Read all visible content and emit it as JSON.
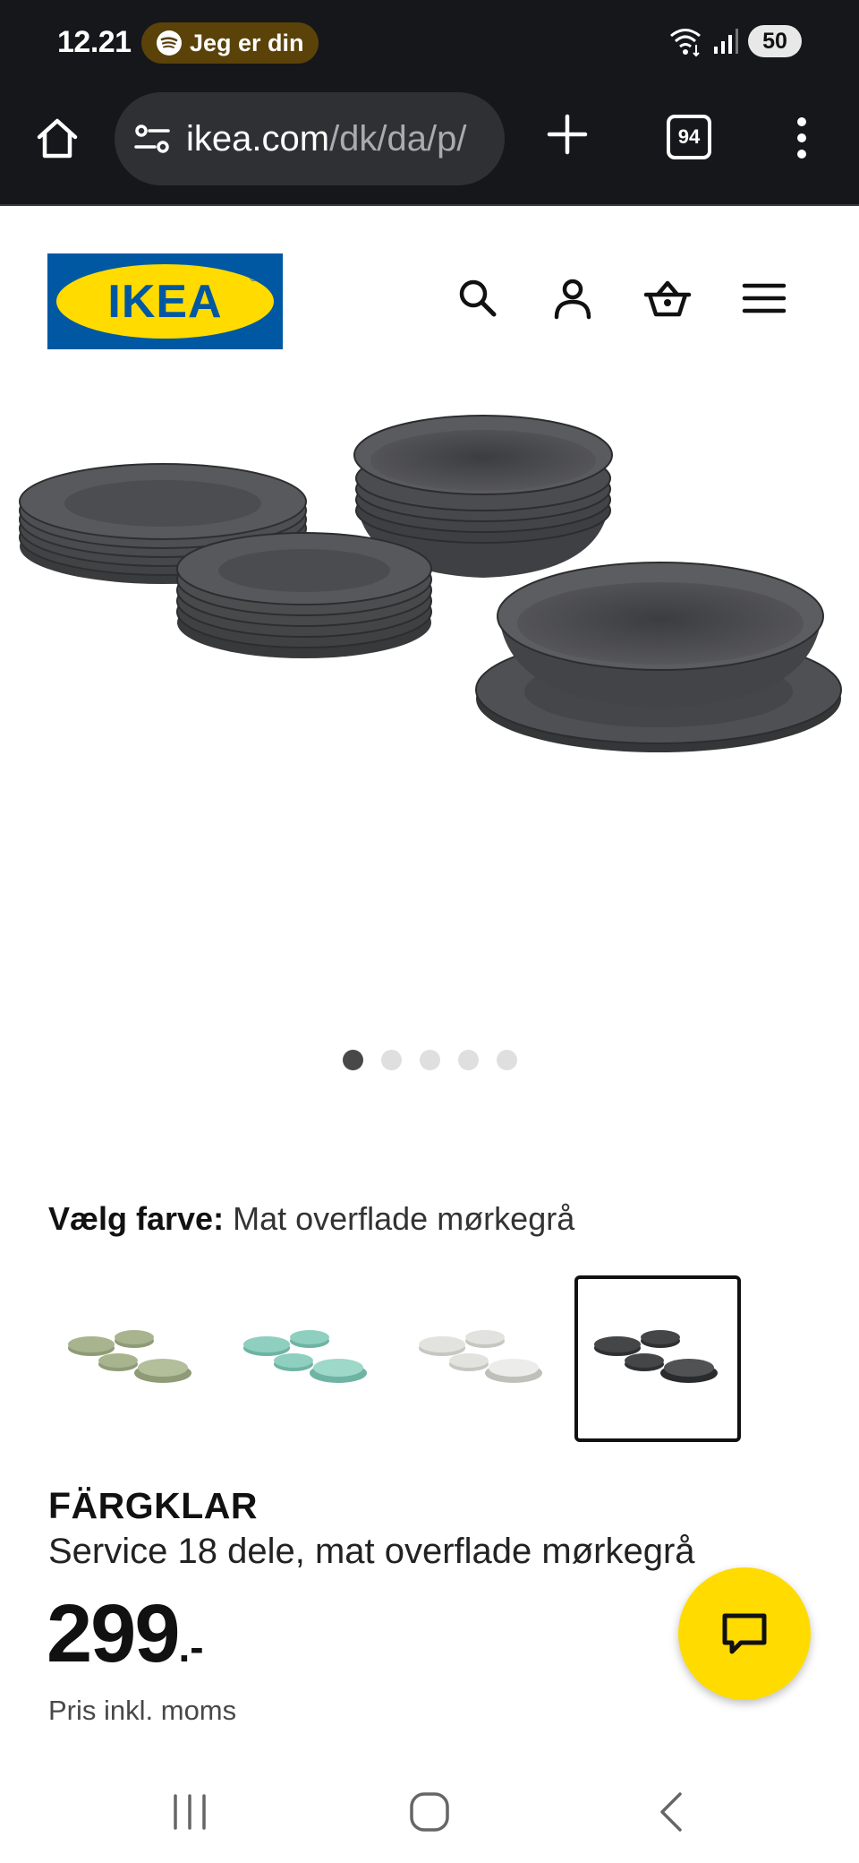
{
  "status_bar": {
    "time": "12.21",
    "media_pill": "Jeg er din",
    "battery": "50",
    "icons": [
      "spotify-icon",
      "wifi-icon",
      "signal-icon",
      "battery-icon"
    ]
  },
  "browser": {
    "url_host": "ikea.com",
    "url_path": "/dk/da/p/",
    "tab_count": "94",
    "icons": [
      "home-icon",
      "site-settings-icon",
      "new-tab-icon",
      "tab-switcher-icon",
      "menu-icon"
    ]
  },
  "header": {
    "logo_text": "IKEA",
    "icons": [
      "search-icon",
      "account-icon",
      "basket-icon",
      "hamburger-menu-icon"
    ]
  },
  "gallery": {
    "dot_count": 5,
    "active_index": 0
  },
  "color_picker": {
    "label": "Vælg farve:",
    "value": "Mat overflade mørkegrå",
    "swatches": [
      {
        "name": "green",
        "color": "#a8b48e",
        "selected": false
      },
      {
        "name": "turquoise",
        "color": "#8fcfbf",
        "selected": false
      },
      {
        "name": "light-grey",
        "color": "#e2e2de",
        "selected": false
      },
      {
        "name": "dark-grey",
        "color": "#444648",
        "selected": true
      }
    ]
  },
  "product": {
    "name": "FÄRGKLAR",
    "description": "Service 18 dele, mat overflade mørkegrå",
    "price": "299",
    "price_suffix": ".-",
    "price_note": "Pris inkl. moms"
  },
  "colors": {
    "brand_blue": "#0058a3",
    "brand_yellow": "#ffdb00",
    "browser_chrome": "#16171b"
  },
  "nav_bar": {
    "icons": [
      "recent-apps-icon",
      "home-nav-icon",
      "back-icon"
    ]
  }
}
